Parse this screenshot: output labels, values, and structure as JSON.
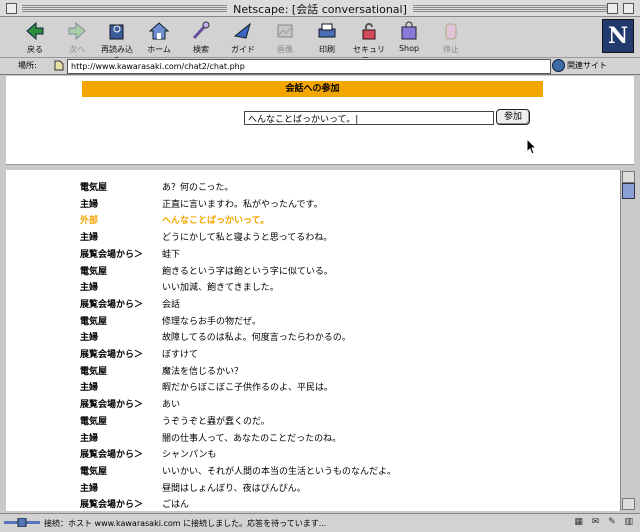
{
  "window": {
    "title": "Netscape: [会話 conversational]"
  },
  "toolbar": {
    "buttons": [
      {
        "label": "戻る",
        "icon": "back-arrow-icon",
        "enabled": true
      },
      {
        "label": "次へ",
        "icon": "forward-arrow-icon",
        "enabled": false
      },
      {
        "label": "再読み込み",
        "icon": "reload-icon",
        "enabled": true
      },
      {
        "label": "ホーム",
        "icon": "home-icon",
        "enabled": true
      },
      {
        "label": "検索",
        "icon": "search-icon",
        "enabled": true
      },
      {
        "label": "ガイド",
        "icon": "guide-icon",
        "enabled": true
      },
      {
        "label": "画像",
        "icon": "images-icon",
        "enabled": false
      },
      {
        "label": "印刷",
        "icon": "print-icon",
        "enabled": true
      },
      {
        "label": "セキュリティ",
        "icon": "security-lock-icon",
        "enabled": true
      },
      {
        "label": "Shop",
        "icon": "shop-icon",
        "enabled": true
      },
      {
        "label": "停止",
        "icon": "stop-icon",
        "enabled": false
      }
    ],
    "logo": "N"
  },
  "location": {
    "label": "場所:",
    "url": "http://www.kawarasaki.com/chat2/chat.php",
    "related_label": "関連サイト"
  },
  "top": {
    "banner": "会話への参加",
    "input_value": "へんなことばっかいって。|",
    "join_button": "参加"
  },
  "chat": {
    "rows": [
      {
        "speaker": "電気屋",
        "message": "あ？何のこった。"
      },
      {
        "speaker": "主婦",
        "message": "正直に言いますわ。私がやったんです。"
      },
      {
        "speaker": "外部",
        "message": "へんなことばっかいって。",
        "highlight": true
      },
      {
        "speaker": "主婦",
        "message": "どうにかして私と寝ようと思ってるわね。"
      },
      {
        "speaker": "展覧会場から＞",
        "message": "蛙下"
      },
      {
        "speaker": "電気屋",
        "message": "飽きるという字は飽という字に似ている。"
      },
      {
        "speaker": "主婦",
        "message": "いい加減、飽きてきました。"
      },
      {
        "speaker": "展覧会場から＞",
        "message": "会話"
      },
      {
        "speaker": "電気屋",
        "message": "修理ならお手の物だぜ。"
      },
      {
        "speaker": "主婦",
        "message": "故障してるのは私よ。何度言ったらわかるの。"
      },
      {
        "speaker": "展覧会場から＞",
        "message": "ぼすけて"
      },
      {
        "speaker": "電気屋",
        "message": "魔法を信じるかい？"
      },
      {
        "speaker": "主婦",
        "message": "暇だからぼこぼこ子供作るのよ、平民は。"
      },
      {
        "speaker": "展覧会場から＞",
        "message": "あい"
      },
      {
        "speaker": "電気屋",
        "message": "うぞうぞと蟲が蠢くのだ。"
      },
      {
        "speaker": "主婦",
        "message": "闇の仕事人って、あなたのことだったのね。"
      },
      {
        "speaker": "展覧会場から＞",
        "message": "シャンパンも"
      },
      {
        "speaker": "電気屋",
        "message": "いいかい、それが人間の本当の生活というものなんだよ。"
      },
      {
        "speaker": "主婦",
        "message": "昼間はしょんぼり、夜はぴんぴん。"
      },
      {
        "speaker": "展覧会場から＞",
        "message": "ごはん"
      }
    ]
  },
  "status": {
    "text": "接続：ホスト www.kawarasaki.com に接続しました。応答を待っています..."
  },
  "colors": {
    "banner": "#f3a500",
    "highlight": "#f3a500",
    "scroll_thumb": "#8a9fd6"
  }
}
